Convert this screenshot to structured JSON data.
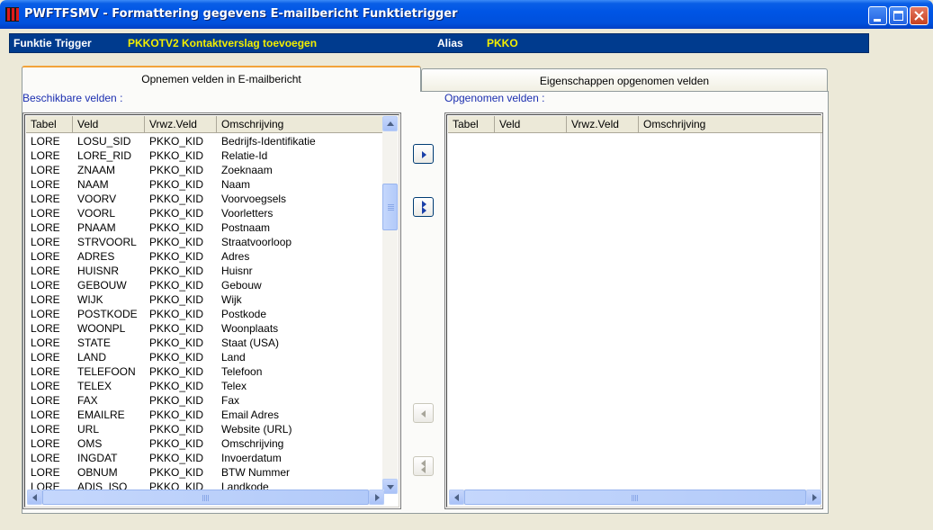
{
  "window": {
    "title": "PWFTFSMV - Formattering gegevens E-mailbericht Funktietrigger"
  },
  "infobar": {
    "funktie_label": "Funktie Trigger",
    "funktie_value": "PKKOTV2  Kontaktverslag toevoegen",
    "alias_label": "Alias",
    "alias_value": "PKKO"
  },
  "tabs": [
    {
      "label": "Opnemen velden in E-mailbericht",
      "active": true
    },
    {
      "label": "Eigenschappen opgenomen velden",
      "active": false
    }
  ],
  "left_panel": {
    "label": "Beschikbare velden :",
    "columns": [
      "Tabel",
      "Veld",
      "Vrwz.Veld",
      "Omschrijving"
    ],
    "rows": [
      [
        "LORE",
        "LOSU_SID",
        "PKKO_KID",
        "Bedrijfs-Identifikatie"
      ],
      [
        "LORE",
        "LORE_RID",
        "PKKO_KID",
        "Relatie-Id"
      ],
      [
        "LORE",
        "ZNAAM",
        "PKKO_KID",
        "Zoeknaam"
      ],
      [
        "LORE",
        "NAAM",
        "PKKO_KID",
        "Naam"
      ],
      [
        "LORE",
        "VOORV",
        "PKKO_KID",
        "Voorvoegsels"
      ],
      [
        "LORE",
        "VOORL",
        "PKKO_KID",
        "Voorletters"
      ],
      [
        "LORE",
        "PNAAM",
        "PKKO_KID",
        "Postnaam"
      ],
      [
        "LORE",
        "STRVOORL",
        "PKKO_KID",
        "Straatvoorloop"
      ],
      [
        "LORE",
        "ADRES",
        "PKKO_KID",
        "Adres"
      ],
      [
        "LORE",
        "HUISNR",
        "PKKO_KID",
        "Huisnr"
      ],
      [
        "LORE",
        "GEBOUW",
        "PKKO_KID",
        "Gebouw"
      ],
      [
        "LORE",
        "WIJK",
        "PKKO_KID",
        "Wijk"
      ],
      [
        "LORE",
        "POSTKODE",
        "PKKO_KID",
        "Postkode"
      ],
      [
        "LORE",
        "WOONPL",
        "PKKO_KID",
        "Woonplaats"
      ],
      [
        "LORE",
        "STATE",
        "PKKO_KID",
        "Staat (USA)"
      ],
      [
        "LORE",
        "LAND",
        "PKKO_KID",
        "Land"
      ],
      [
        "LORE",
        "TELEFOON",
        "PKKO_KID",
        "Telefoon"
      ],
      [
        "LORE",
        "TELEX",
        "PKKO_KID",
        "Telex"
      ],
      [
        "LORE",
        "FAX",
        "PKKO_KID",
        "Fax"
      ],
      [
        "LORE",
        "EMAILRE",
        "PKKO_KID",
        "Email Adres"
      ],
      [
        "LORE",
        "URL",
        "PKKO_KID",
        "Website (URL)"
      ],
      [
        "LORE",
        "OMS",
        "PKKO_KID",
        "Omschrijving"
      ],
      [
        "LORE",
        "INGDAT",
        "PKKO_KID",
        "Invoerdatum"
      ],
      [
        "LORE",
        "OBNUM",
        "PKKO_KID",
        "BTW Nummer"
      ],
      [
        "LORE",
        "ADIS_ISO",
        "PKKO_KID",
        "Landkode"
      ]
    ]
  },
  "right_panel": {
    "label": "Opgenomen velden :",
    "columns": [
      "Tabel",
      "Veld",
      "Vrwz.Veld",
      "Omschrijving"
    ],
    "rows": []
  },
  "transfer_buttons": [
    {
      "icon": "move-right-icon",
      "enabled": true
    },
    {
      "icon": "move-all-right-icon",
      "enabled": true
    },
    {
      "icon": "move-left-icon",
      "enabled": false
    },
    {
      "icon": "move-all-left-icon",
      "enabled": false
    }
  ],
  "colors": {
    "titlebar": "#0055e5",
    "infobar": "#003b8e",
    "infobar_value": "#f3ee00",
    "section_label": "#1c2fb0",
    "tab_accent": "#f2a33a"
  }
}
